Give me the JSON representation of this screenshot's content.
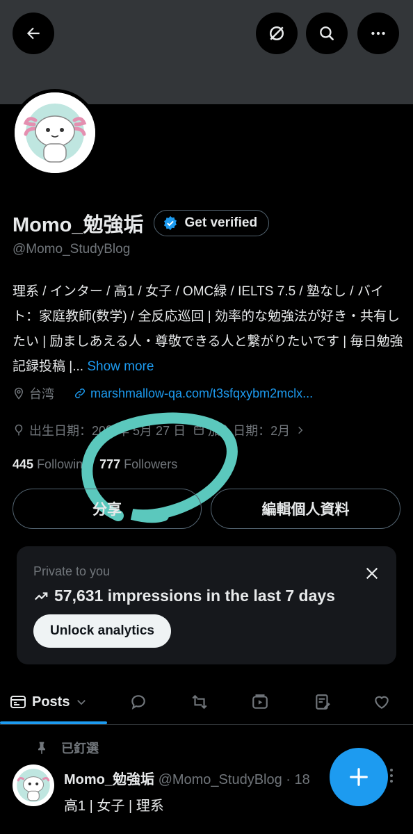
{
  "header": {
    "back_icon": "arrow-left-icon",
    "grok_icon": "slash-circle-icon",
    "search_icon": "search-icon",
    "more_icon": "more-horizontal-icon"
  },
  "profile": {
    "display_name": "Momo_勉強垢",
    "get_verified_label": "Get verified",
    "handle": "@Momo_StudyBlog",
    "bio_text": "理系 / インター / 高1 / 女子 / OMC緑 / IELTS 7.5 /  塾なし / バイト：家庭教師(数学) /  全反応巡回 | 効率的な勉強法が好き・共有したい | 励ましあえる人・尊敬できる人と繋がりたいです | 毎日勉強記録投稿 |...",
    "show_more": "Show more",
    "location": "台湾",
    "link": "marshmallow-qa.com/t3sfqxybm2mclx...",
    "birth_label": "出生日期：20",
    "birth_hidden": "0",
    "birth_rest": "年 5月 27 日",
    "joined": "加入日期：2月",
    "following_count": "445",
    "following_label": "Following",
    "followers_count": "777",
    "followers_label": "Followers"
  },
  "actions": {
    "share_label": "分享",
    "edit_label": "編輯個人資料"
  },
  "analytics": {
    "private_label": "Private to you",
    "impressions_text": "57,631 impressions in the last 7 days",
    "unlock_label": "Unlock analytics"
  },
  "tabs": {
    "posts_label": "Posts",
    "items": [
      "posts",
      "replies",
      "reposts",
      "media",
      "articles",
      "likes"
    ]
  },
  "pinned_post": {
    "pinned_label": "已釘選",
    "author": "Momo_勉強垢",
    "handle": "@Momo_StudyBlog",
    "separator": "·",
    "time": "18",
    "text": "高1 | 女子 | 理系"
  },
  "colors": {
    "accent": "#1d9bf0",
    "annotation": "#5bc8bd",
    "banner": "#333639"
  }
}
